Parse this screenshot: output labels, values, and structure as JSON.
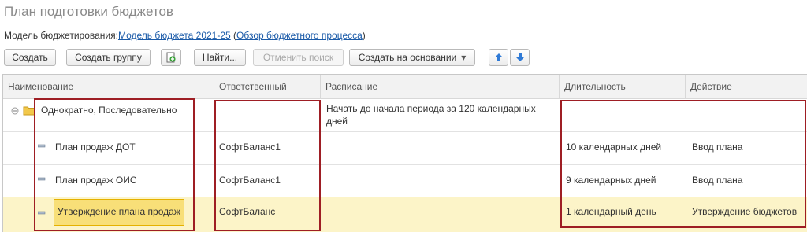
{
  "page": {
    "title": "План подготовки бюджетов",
    "model_label": "Модель бюджетирования:",
    "model_link": "Модель бюджета 2021-25",
    "review_open": "(",
    "review_link": "Обзор бюджетного процесса",
    "review_close": ")"
  },
  "toolbar": {
    "create": "Создать",
    "create_group": "Создать группу",
    "find": "Найти...",
    "cancel_search": "Отменить поиск",
    "create_based_on": "Создать на основании",
    "dropdown_arrow": "▾"
  },
  "table": {
    "headers": [
      "Наименование",
      "Ответственный",
      "Расписание",
      "Длительность",
      "Действие"
    ],
    "rows": [
      {
        "name": "Однократно, Последовательно",
        "responsible": "",
        "schedule": "Начать до начала периода за 120 календарных дней",
        "duration": "",
        "action": ""
      },
      {
        "name": "План продаж ДОТ",
        "responsible": "СофтБаланс1",
        "schedule": "",
        "duration": "10 календарных дней",
        "action": "Ввод плана"
      },
      {
        "name": "План продаж ОИС",
        "responsible": "СофтБаланс1",
        "schedule": "",
        "duration": "9 календарных дней",
        "action": "Ввод плана"
      },
      {
        "name": "Утверждение плана продаж",
        "responsible": "СофтБаланс",
        "schedule": "",
        "duration": "1 календарный день",
        "action": "Утверждение бюджетов"
      }
    ]
  },
  "colors": {
    "annotation_box": "#9e1e24",
    "selected_row": "#fcf4c8",
    "selected_cell": "#f8df78",
    "link": "#1a5aa8",
    "arrow_button": "#2f7ad6"
  },
  "icons": [
    "add-from-template-icon",
    "move-up-icon",
    "move-down-icon",
    "collapse-icon",
    "folder-icon",
    "item-dash-icon"
  ]
}
